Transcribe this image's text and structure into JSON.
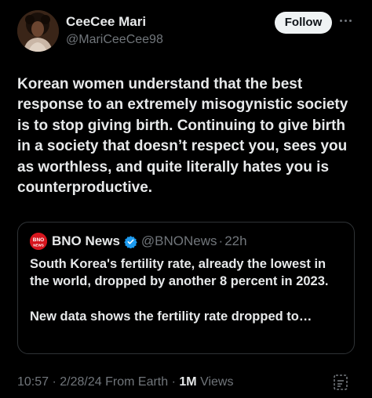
{
  "author": {
    "display_name": "CeeCee Mari",
    "handle": "@MariCeeCee98"
  },
  "actions": {
    "follow_label": "Follow",
    "more_icon": "more-horizontal-icon"
  },
  "tweet": {
    "text": "Korean women understand that the best response to an extremely misogynistic society is to stop giving birth. Continuing to give birth in a society that doesn’t respect you, sees you as worthless, and quite literally hates you is counterproductive."
  },
  "quote": {
    "avatar_text": "BNO",
    "avatar_subtext": "NEWS",
    "name": "BNO News",
    "handle": "@BNONews",
    "separator": "·",
    "time": "22h",
    "body_lines": [
      "South Korea's fertility rate, already the lowest in the world, dropped by another 8 percent in 2023.",
      "New data shows the fertility rate dropped to…"
    ]
  },
  "meta": {
    "time": "10:57",
    "date": "2/28/24",
    "source": "From Earth",
    "views_count": "1M",
    "views_label": "Views",
    "separator": "·"
  },
  "colors": {
    "background": "#000000",
    "text": "#e7e9ea",
    "secondary": "#71767b",
    "verified": "#1d9bf0",
    "bno_red": "#d6161e"
  }
}
